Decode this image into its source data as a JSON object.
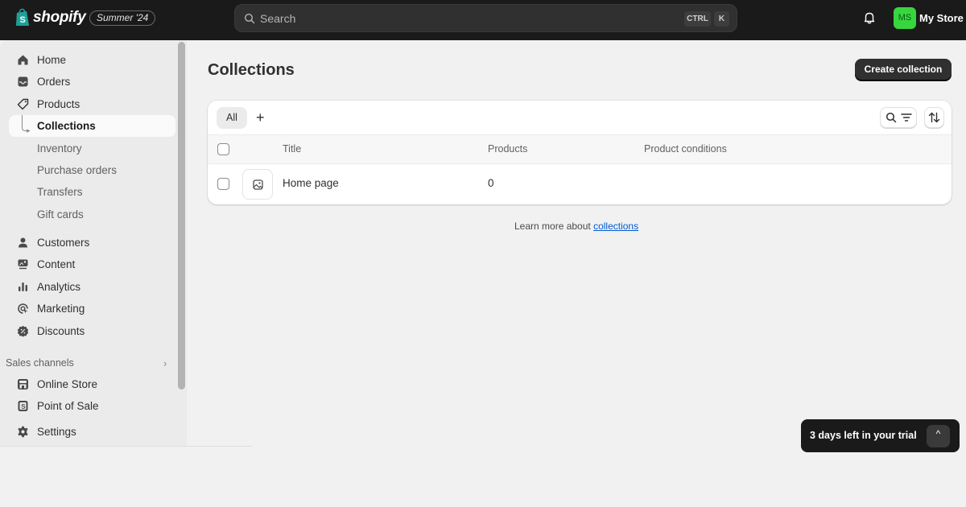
{
  "topbar": {
    "brand": "shopify",
    "edition_badge": "Summer '24",
    "search": {
      "placeholder": "Search",
      "shortcut_keys": [
        "CTRL",
        "K"
      ]
    },
    "notifications_icon": "bell-icon",
    "account": {
      "initials": "MS",
      "store_name": "My Store",
      "avatar_color": "#37d63e"
    }
  },
  "sidebar": {
    "items": [
      {
        "label": "Home",
        "icon": "home-icon"
      },
      {
        "label": "Orders",
        "icon": "inbox-icon"
      },
      {
        "label": "Products",
        "icon": "tag-icon"
      },
      {
        "label": "Collections",
        "sub": true,
        "active": true
      },
      {
        "label": "Inventory",
        "sub": true
      },
      {
        "label": "Purchase orders",
        "sub": true
      },
      {
        "label": "Transfers",
        "sub": true
      },
      {
        "label": "Gift cards",
        "sub": true
      },
      {
        "label": "Customers",
        "icon": "person-icon"
      },
      {
        "label": "Content",
        "icon": "content-icon"
      },
      {
        "label": "Analytics",
        "icon": "bar-chart-icon"
      },
      {
        "label": "Marketing",
        "icon": "target-icon"
      },
      {
        "label": "Discounts",
        "icon": "discount-icon"
      }
    ],
    "sales_channels": {
      "label": "Sales channels",
      "items": [
        {
          "label": "Online Store",
          "icon": "store-icon"
        },
        {
          "label": "Point of Sale",
          "icon": "pos-icon"
        }
      ]
    },
    "settings": {
      "label": "Settings",
      "icon": "gear-icon"
    }
  },
  "main": {
    "title": "Collections",
    "primary_action": "Create collection",
    "tabs": [
      {
        "label": "All",
        "selected": true
      }
    ],
    "add_view_label": "+",
    "table": {
      "columns": [
        "Title",
        "Products",
        "Product conditions"
      ],
      "rows": [
        {
          "title": "Home page",
          "products": "0",
          "conditions": ""
        }
      ]
    },
    "footer": {
      "text": "Learn more about",
      "link": "collections"
    }
  },
  "trial_banner": {
    "text": "3 days left in your trial",
    "toggle": "^"
  },
  "colors": {
    "topbar": "#1a1a1a",
    "primary_button": "#303030",
    "link": "#005bd3",
    "background": "#f1f1f1"
  }
}
